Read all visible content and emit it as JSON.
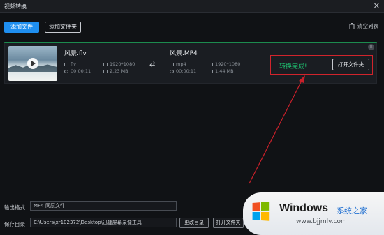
{
  "window": {
    "title": "视频转换",
    "close_glyph": "✕"
  },
  "toolbar": {
    "add_file": "添加文件",
    "add_folder": "添加文件夹",
    "clear_list": "清空列表"
  },
  "task": {
    "source": {
      "name": "风景.flv",
      "format": "flv",
      "resolution": "1920*1080",
      "duration": "00:00:11",
      "size": "2.23 MB"
    },
    "target": {
      "name": "风景.MP4",
      "format": "mp4",
      "resolution": "1920*1080",
      "duration": "00:00:11",
      "size": "1.44 MB"
    },
    "status": "转换完成!",
    "open_folder": "打开文件夹",
    "close_glyph": "×"
  },
  "output": {
    "format_label": "输出格式",
    "format_value": "MP4 同原文件",
    "save_label": "保存目录",
    "save_path": "C:\\Users\\xr102372\\Desktop\\迅捷屏幕录像工具",
    "change_dir": "更改目录",
    "open_folder": "打开文件夹"
  },
  "watermark": {
    "title": "Windows",
    "subtitle": "系统之家",
    "url": "www.bjjmlv.com"
  },
  "colors": {
    "accent": "#1f8ff0",
    "success": "#1fbf70",
    "highlight": "#d1242c"
  },
  "icons": [
    "close-icon",
    "trash-icon",
    "play-icon",
    "shuffle-icon",
    "format-icon",
    "resolution-icon",
    "clock-icon",
    "size-icon",
    "windows-logo-icon"
  ]
}
